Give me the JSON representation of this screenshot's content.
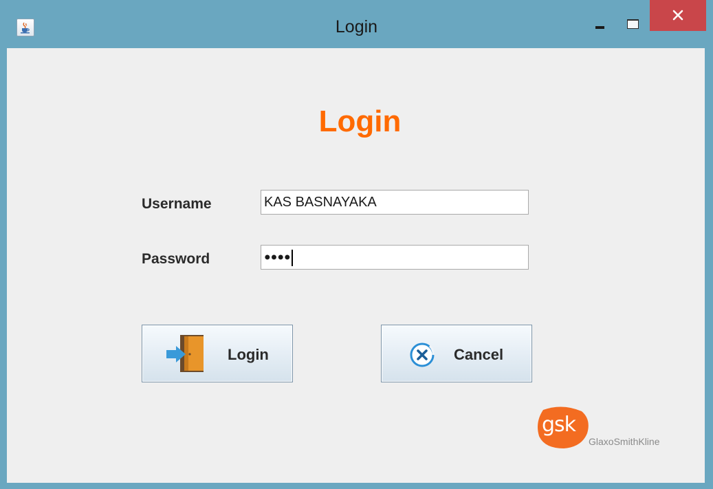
{
  "window": {
    "title": "Login",
    "icons": {
      "app": "java-cup-icon",
      "minimize": "minimize-icon",
      "maximize": "maximize-icon",
      "close": "close-icon"
    }
  },
  "form": {
    "heading": "Login",
    "username_label": "Username",
    "username_value": "KAS BASNAYAKA",
    "password_label": "Password",
    "password_masked": "●●●●"
  },
  "buttons": {
    "login_label": "Login",
    "login_icon": "door-enter-icon",
    "cancel_label": "Cancel",
    "cancel_icon": "cancel-circle-icon"
  },
  "branding": {
    "logo_text": "gsk",
    "company_name": "GlaxoSmithKline"
  },
  "colors": {
    "titlebar": "#6aa7c0",
    "heading": "#ff6a00",
    "close_button": "#c9464a",
    "logo_orange": "#f36c21"
  }
}
